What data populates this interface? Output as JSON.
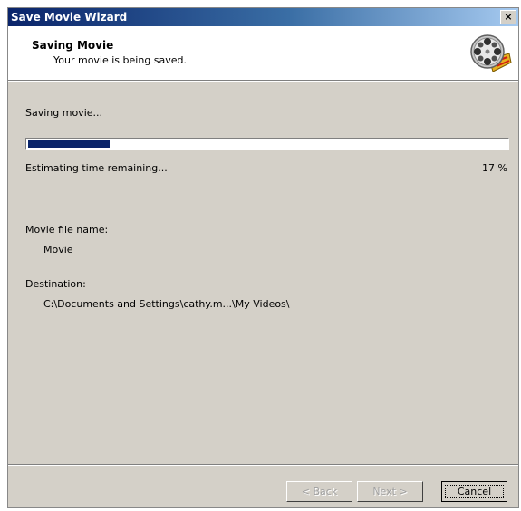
{
  "window": {
    "title": "Save Movie Wizard",
    "close_label": "×"
  },
  "header": {
    "title": "Saving Movie",
    "subtitle": "Your movie is being saved.",
    "logo_icon": "film-reel-icon"
  },
  "progress": {
    "label": "Saving movie...",
    "status": "Estimating time remaining...",
    "percent_text": "17 %",
    "percent_value": 17,
    "fill_color": "#0a246a"
  },
  "details": {
    "file_name_label": "Movie file name:",
    "file_name_value": "Movie",
    "destination_label": "Destination:",
    "destination_value": "C:\\Documents and Settings\\cathy.m...\\My Videos\\"
  },
  "buttons": {
    "back": "< Back",
    "next": "Next >",
    "cancel": "Cancel"
  }
}
